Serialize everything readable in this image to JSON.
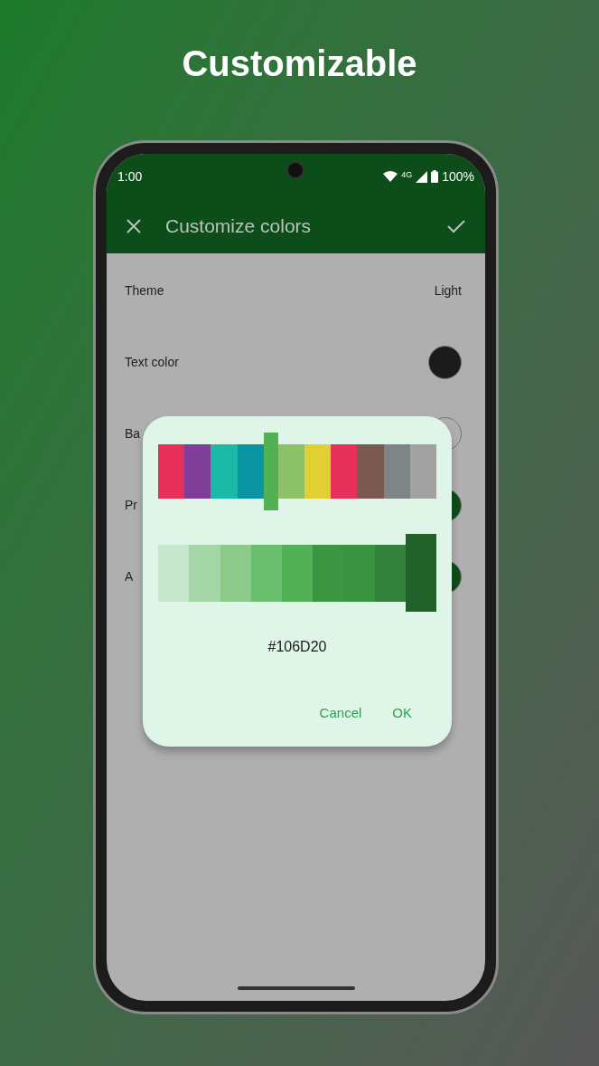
{
  "headline": "Customizable",
  "status_bar": {
    "time": "1:00",
    "network": "4G",
    "battery": "100%"
  },
  "app_bar": {
    "title": "Customize colors"
  },
  "settings": [
    {
      "label": "Theme",
      "kind": "value",
      "value": "Light"
    },
    {
      "label": "Text color",
      "kind": "swatch",
      "color": "#1a1c1a"
    },
    {
      "label": "Ba",
      "kind": "swatch",
      "color": "#afafaf"
    },
    {
      "label": "Pr",
      "kind": "swatch",
      "color": "#0d4d1a"
    },
    {
      "label": "A",
      "kind": "swatch",
      "color": "#0d4d1a"
    }
  ],
  "dialog": {
    "palette": [
      {
        "color": "#e8315a",
        "selected": false
      },
      {
        "color": "#7f3f98",
        "selected": false
      },
      {
        "color": "#1cb9a9",
        "selected": false
      },
      {
        "color": "#0b95a3",
        "selected": false
      },
      {
        "color": "#52b055",
        "selected": true
      },
      {
        "color": "#8dc26b",
        "selected": false
      },
      {
        "color": "#e0d033",
        "selected": false
      },
      {
        "color": "#e8315a",
        "selected": false
      },
      {
        "color": "#7a5a50",
        "selected": false
      },
      {
        "color": "#7f8587",
        "selected": false
      },
      {
        "color": "#a2a2a2",
        "selected": false
      }
    ],
    "shades": [
      {
        "color": "#c8e6cc",
        "selected": false
      },
      {
        "color": "#a5d6a7",
        "selected": false
      },
      {
        "color": "#8bca88",
        "selected": false
      },
      {
        "color": "#6abf6e",
        "selected": false
      },
      {
        "color": "#52b055",
        "selected": false
      },
      {
        "color": "#3c9641",
        "selected": false
      },
      {
        "color": "#3a9340",
        "selected": false
      },
      {
        "color": "#33813a",
        "selected": false
      },
      {
        "color": "#21612a",
        "selected": true
      }
    ],
    "hex": "#106D20",
    "buttons": [
      "Cancel",
      "OK"
    ]
  }
}
